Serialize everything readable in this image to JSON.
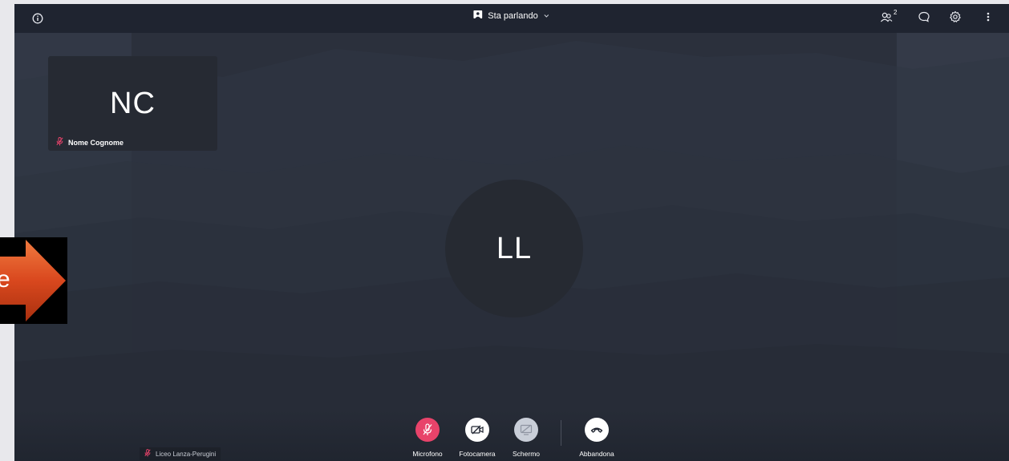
{
  "topbar": {
    "info_icon": "info-icon",
    "view_label": "Sta parlando",
    "participants_count": "2",
    "icons": [
      "participants-icon",
      "chat-icon",
      "settings-icon",
      "more-icon"
    ]
  },
  "thumbnail": {
    "initials": "NC",
    "name": "Nome Cognome",
    "mic_state": "muted"
  },
  "main_participant": {
    "initials": "LL"
  },
  "overlay": {
    "arrow_text": "e",
    "arrow_color": "#d9481e"
  },
  "self_view": {
    "name": "Liceo Lanza-Perugini",
    "mic_state": "muted"
  },
  "controls": [
    {
      "label": "Microfono",
      "icon": "mic-off-icon",
      "color": "#e8436a"
    },
    {
      "label": "Fotocamera",
      "icon": "camera-off-icon",
      "color": "#ffffff"
    },
    {
      "label": "Schermo",
      "icon": "screen-share-icon",
      "color": "#d0d5df"
    },
    {
      "label": "Abbandona",
      "icon": "hang-up-icon",
      "color": "#ffffff"
    }
  ]
}
